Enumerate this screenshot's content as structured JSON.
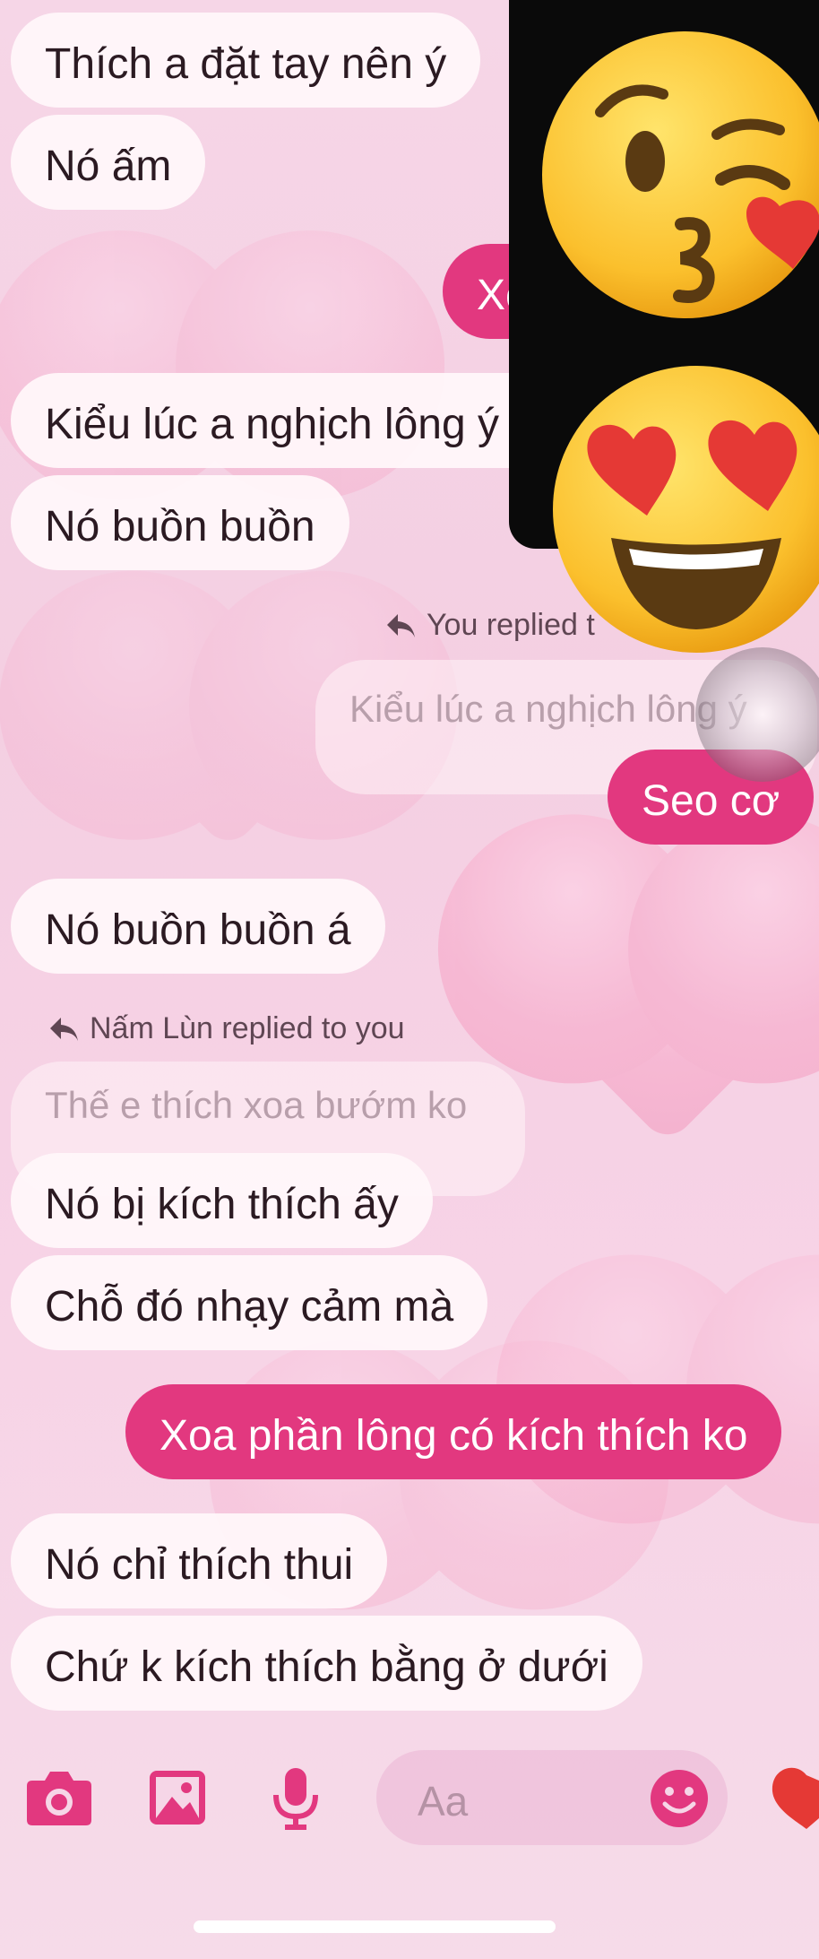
{
  "messages": [
    {
      "text": "Thích a đặt tay nên ý"
    },
    {
      "text": "Nó ấm"
    },
    {
      "text": "Xo"
    },
    {
      "text": "Kiểu lúc a nghịch lông ý"
    },
    {
      "text": "Nó buồn buồn"
    },
    {
      "reply_label": "You replied t",
      "quote": "Kiểu lúc a nghịch lông ý",
      "text": "Seo cơ"
    },
    {
      "text": "Nó buồn buồn á"
    },
    {
      "reply_label": "Nấm Lùn replied to you",
      "quote": "Thế e thích xoa bướm ko",
      "text": "Nó bị kích thích ấy"
    },
    {
      "text": "Chỗ đó nhạy cảm mà"
    },
    {
      "text": "Xoa phần lông có kích thích ko"
    },
    {
      "text": "Nó chỉ thích thui"
    },
    {
      "text": "Chứ k kích thích bằng ở dưới"
    }
  ],
  "composer": {
    "placeholder": "Aa",
    "icons": [
      "camera-icon",
      "image-icon",
      "microphone-icon",
      "emoji-icon",
      "heart-icon"
    ]
  },
  "overlay_emojis": [
    "kissing-face-wink-emoji",
    "heart-eyes-emoji"
  ],
  "colors": {
    "sent_bubble": "#e2387f",
    "received_bubble": "#fff7fa",
    "accent": "#e2387f",
    "background": "#f6d6e7"
  }
}
